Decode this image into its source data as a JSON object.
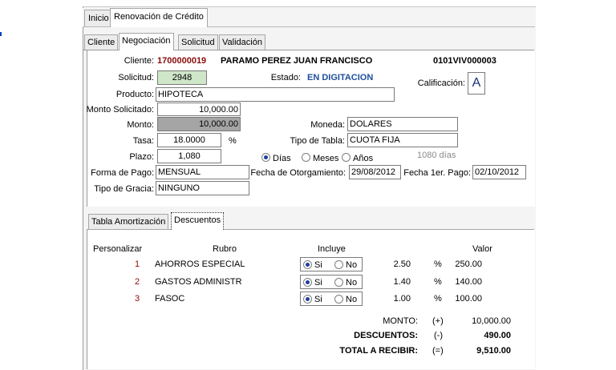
{
  "window_tabs": [
    "Inicio",
    "Renovación de Crédito"
  ],
  "sub_tabs": [
    "Cliente",
    "Negociación",
    "Solicitud",
    "Validación"
  ],
  "cliente": {
    "label": "Cliente:",
    "code": "1700000019",
    "name": "PARAMO PEREZ JUAN FRANCISCO",
    "account": "0101VIV000003"
  },
  "solicitud": {
    "label": "Solicitud:",
    "value": "2948"
  },
  "estado": {
    "label": "Estado:",
    "value": "EN DIGITACION"
  },
  "calificacion": {
    "label": "Calificación:",
    "value": "A"
  },
  "producto": {
    "label": "Producto:",
    "value": "HIPOTECA"
  },
  "monto_solicitado": {
    "label": "Monto Solicitado:",
    "value": "10,000.00"
  },
  "monto": {
    "label": "Monto:",
    "value": "10,000.00"
  },
  "moneda": {
    "label": "Moneda:",
    "value": "DOLARES"
  },
  "tasa": {
    "label": "Tasa:",
    "value": "18.0000",
    "unit": "%"
  },
  "tipo_tabla": {
    "label": "Tipo de Tabla:",
    "value": "CUOTA FIJA"
  },
  "plazo": {
    "label": "Plazo:",
    "value": "1,080",
    "options": [
      "Días",
      "Meses",
      "Años"
    ],
    "selected": "Días",
    "equivalent": "1080 días"
  },
  "forma_pago": {
    "label": "Forma de Pago:",
    "value": "MENSUAL"
  },
  "fecha_otorgamiento": {
    "label": "Fecha de Otorgamiento:",
    "value": "29/08/2012"
  },
  "fecha_pago": {
    "label": "Fecha 1er. Pago:",
    "value": "02/10/2012"
  },
  "tipo_gracia": {
    "label": "Tipo de Gracia:",
    "value": "NINGUNO"
  },
  "lower_tabs": [
    "Tabla Amortización",
    "Descuentos"
  ],
  "descuentos": {
    "headers": {
      "personalizar": "Personalizar",
      "rubro": "Rubro",
      "incluye": "Incluye",
      "valor": "Valor"
    },
    "yes_label": "Si",
    "no_label": "No",
    "rows": [
      {
        "num": "1",
        "rubro": "AHORROS ESPECIAL",
        "incluye": "Si",
        "pct": "2.50",
        "pct_sign": "%",
        "valor": "250.00"
      },
      {
        "num": "2",
        "rubro": "GASTOS ADMINISTR",
        "incluye": "Si",
        "pct": "1.40",
        "pct_sign": "%",
        "valor": "140.00"
      },
      {
        "num": "3",
        "rubro": "FASOC",
        "incluye": "Si",
        "pct": "1.00",
        "pct_sign": "%",
        "valor": "100.00"
      }
    ],
    "totals": [
      {
        "label": "MONTO:",
        "sign": "(+)",
        "value": "10,000.00"
      },
      {
        "label": "DESCUENTOS:",
        "sign": "(-)",
        "value": "490.00"
      },
      {
        "label": "TOTAL A RECIBIR:",
        "sign": "(=)",
        "value": "9,510.00"
      }
    ]
  },
  "colors": {
    "code": "#8b0a0a",
    "estado": "#1d4f9c",
    "solicitud_bg": "#cfe6c8",
    "monto_bg": "#a5a5a5"
  }
}
